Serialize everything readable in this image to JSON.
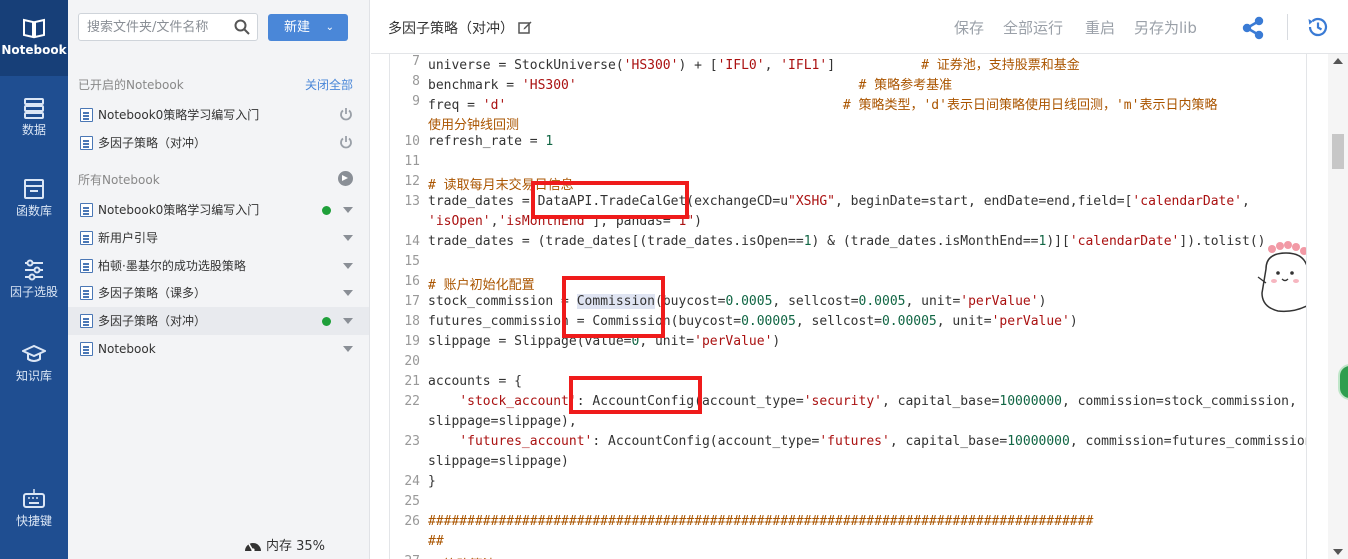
{
  "rail": {
    "items": [
      {
        "label": "Notebook",
        "icon": "book-icon"
      },
      {
        "label": "数据",
        "icon": "database-icon"
      },
      {
        "label": "函数库",
        "icon": "function-library-icon"
      },
      {
        "label": "因子选股",
        "icon": "sliders-icon"
      },
      {
        "label": "知识库",
        "icon": "graduation-cap-icon"
      },
      {
        "label": "快捷键",
        "icon": "keyboard-icon"
      }
    ]
  },
  "panel": {
    "search_placeholder": "搜索文件夹/文件名称",
    "new_button": "新建",
    "opened_title": "已开启的Notebook",
    "close_all": "关闭全部",
    "opened": [
      "Notebook0策略学习编写入门",
      "多因子策略（对冲）"
    ],
    "all_title": "所有Notebook",
    "all": [
      "Notebook0策略学习编写入门",
      "新用户引导",
      "柏顿·墨基尔的成功选股策略",
      "多因子策略（课多）",
      "多因子策略（对冲）",
      "Notebook"
    ],
    "memory": "内存 35%"
  },
  "header": {
    "title": "多因子策略（对冲）",
    "save": "保存",
    "run_all": "全部运行",
    "restart": "重启",
    "save_as_lib": "另存为lib"
  },
  "editor": {
    "line_numbers": [
      "7",
      "8",
      "9",
      "10",
      "11",
      "12",
      "13",
      "14",
      "15",
      "16",
      "17",
      "18",
      "19",
      "20",
      "21",
      "22",
      "23",
      "24",
      "25",
      "26",
      "27"
    ]
  },
  "colors": {
    "rail_bg": "#1f4e91",
    "accent": "#4a87d8",
    "highlight_box": "#ef1b1b",
    "status_dot": "#1fa03a"
  }
}
